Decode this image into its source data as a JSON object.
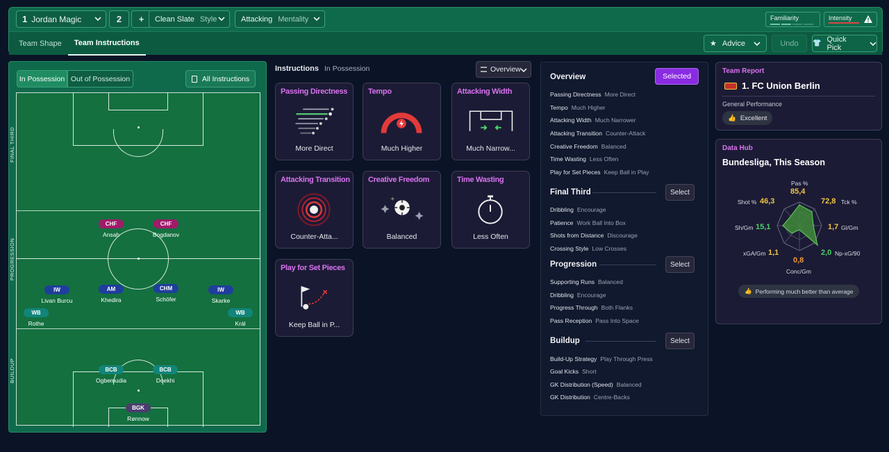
{
  "topbar": {
    "tactic_number": "1",
    "tactic_name": "Jordan Magic",
    "tactic2_number": "2",
    "add_label": "+",
    "style_value": "Clean Slate",
    "style_label": "Style",
    "mentality_value": "Attacking",
    "mentality_label": "Mentality",
    "familiarity_label": "Familiarity",
    "intensity_label": "Intensity",
    "tabs": [
      "Team Shape",
      "Team Instructions"
    ],
    "advice_label": "Advice",
    "undo_label": "Undo",
    "quickpick_label": "Quick Pick"
  },
  "pitch": {
    "toggle_in": "In Possession",
    "toggle_out": "Out of Possession",
    "all_instructions": "All Instructions",
    "zones": [
      "FINAL THIRD",
      "PROGRESSION",
      "BUILDUP"
    ],
    "players": [
      {
        "pos": "CHF",
        "name": "Ansah",
        "color": "#a01b6a"
      },
      {
        "pos": "CHF",
        "name": "Bogdanov",
        "color": "#a01b6a"
      },
      {
        "pos": "IW",
        "name": "Livan Burcu",
        "color": "#1f3e9c"
      },
      {
        "pos": "AM",
        "name": "Khedira",
        "color": "#1f3e9c"
      },
      {
        "pos": "CHM",
        "name": "Schöfer",
        "color": "#1f3e9c"
      },
      {
        "pos": "IW",
        "name": "Skarke",
        "color": "#1f3e9c"
      },
      {
        "pos": "WB",
        "name": "Rothe",
        "color": "#12857a"
      },
      {
        "pos": "WB",
        "name": "Král",
        "color": "#12857a"
      },
      {
        "pos": "BCB",
        "name": "Ogbemudia",
        "color": "#12857a"
      },
      {
        "pos": "BCB",
        "name": "Doekhi",
        "color": "#12857a"
      },
      {
        "pos": "BGK",
        "name": "Rønnow",
        "color": "#4b3d6e"
      }
    ]
  },
  "instructions": {
    "title": "Instructions",
    "subtitle": "In Possession",
    "view_select": "Overview",
    "cards": [
      {
        "title": "Passing Directness",
        "value": "More Direct",
        "icon": "passing-arrows-icon"
      },
      {
        "title": "Tempo",
        "value": "Much Higher",
        "icon": "tempo-gauge-icon"
      },
      {
        "title": "Attacking Width",
        "value": "Much Narrow...",
        "icon": "goal-width-icon"
      },
      {
        "title": "Attacking Transition",
        "value": "Counter-Atta...",
        "icon": "target-rings-icon"
      },
      {
        "title": "Creative Freedom",
        "value": "Balanced",
        "icon": "sparkle-ball-icon"
      },
      {
        "title": "Time Wasting",
        "value": "Less Often",
        "icon": "stopwatch-icon"
      },
      {
        "title": "Play for Set Pieces",
        "value": "Keep Ball in P...",
        "icon": "corner-flag-icon"
      }
    ]
  },
  "overview": {
    "title": "Overview",
    "selected_label": "Selected",
    "select_label": "Select",
    "general": [
      {
        "k": "Passing Directness",
        "v": "More Direct"
      },
      {
        "k": "Tempo",
        "v": "Much Higher"
      },
      {
        "k": "Attacking Width",
        "v": "Much Narrower"
      },
      {
        "k": "Attacking Transition",
        "v": "Counter-Attack"
      },
      {
        "k": "Creative Freedom",
        "v": "Balanced"
      },
      {
        "k": "Time Wasting",
        "v": "Less Often"
      },
      {
        "k": "Play for Set Pieces",
        "v": "Keep Ball in Play"
      }
    ],
    "final_third_title": "Final Third",
    "final_third": [
      {
        "k": "Dribbling",
        "v": "Encourage"
      },
      {
        "k": "Patience",
        "v": "Work Ball Into Box"
      },
      {
        "k": "Shots from Distance",
        "v": "Discourage"
      },
      {
        "k": "Crossing Style",
        "v": "Low Crosses"
      }
    ],
    "progression_title": "Progression",
    "progression": [
      {
        "k": "Supporting Runs",
        "v": "Balanced"
      },
      {
        "k": "Dribbling",
        "v": "Encourage"
      },
      {
        "k": "Progress Through",
        "v": "Both Flanks"
      },
      {
        "k": "Pass Reception",
        "v": "Pass Into Space"
      }
    ],
    "buildup_title": "Buildup",
    "buildup": [
      {
        "k": "Build-Up Strategy",
        "v": "Play Through Press"
      },
      {
        "k": "Goal Kicks",
        "v": "Short"
      },
      {
        "k": "GK Distribution (Speed)",
        "v": "Balanced"
      },
      {
        "k": "GK Distribution",
        "v": "Centre-Backs"
      }
    ]
  },
  "team_report": {
    "header": "Team Report",
    "team": "1. FC Union Berlin",
    "general_label": "General Performance",
    "rating": "Excellent"
  },
  "data_hub": {
    "header": "Data Hub",
    "title": "Bundesliga, This Season",
    "stats": [
      {
        "label": "Pas %",
        "value": "85,4",
        "color": "#f0c542"
      },
      {
        "label": "Tck %",
        "value": "72,8",
        "color": "#f0c542"
      },
      {
        "label": "Gl/Gm",
        "value": "1,7",
        "color": "#f0c542"
      },
      {
        "label": "Np-xG/90",
        "value": "2,0",
        "color": "#4cd06a"
      },
      {
        "label": "Conc/Gm",
        "value": "0,8",
        "color": "#f09a3a"
      },
      {
        "label": "xGA/Gm",
        "value": "1,1",
        "color": "#f0c542"
      },
      {
        "label": "Sh/Gm",
        "value": "15,1",
        "color": "#4cd06a"
      },
      {
        "label": "Shot %",
        "value": "46,3",
        "color": "#f0c542"
      }
    ],
    "footer": "Performing much better than average"
  },
  "colors": {
    "accent_purple": "#d873f0",
    "selected_button": "#8a2be2",
    "pitch_green": "#14703f"
  }
}
